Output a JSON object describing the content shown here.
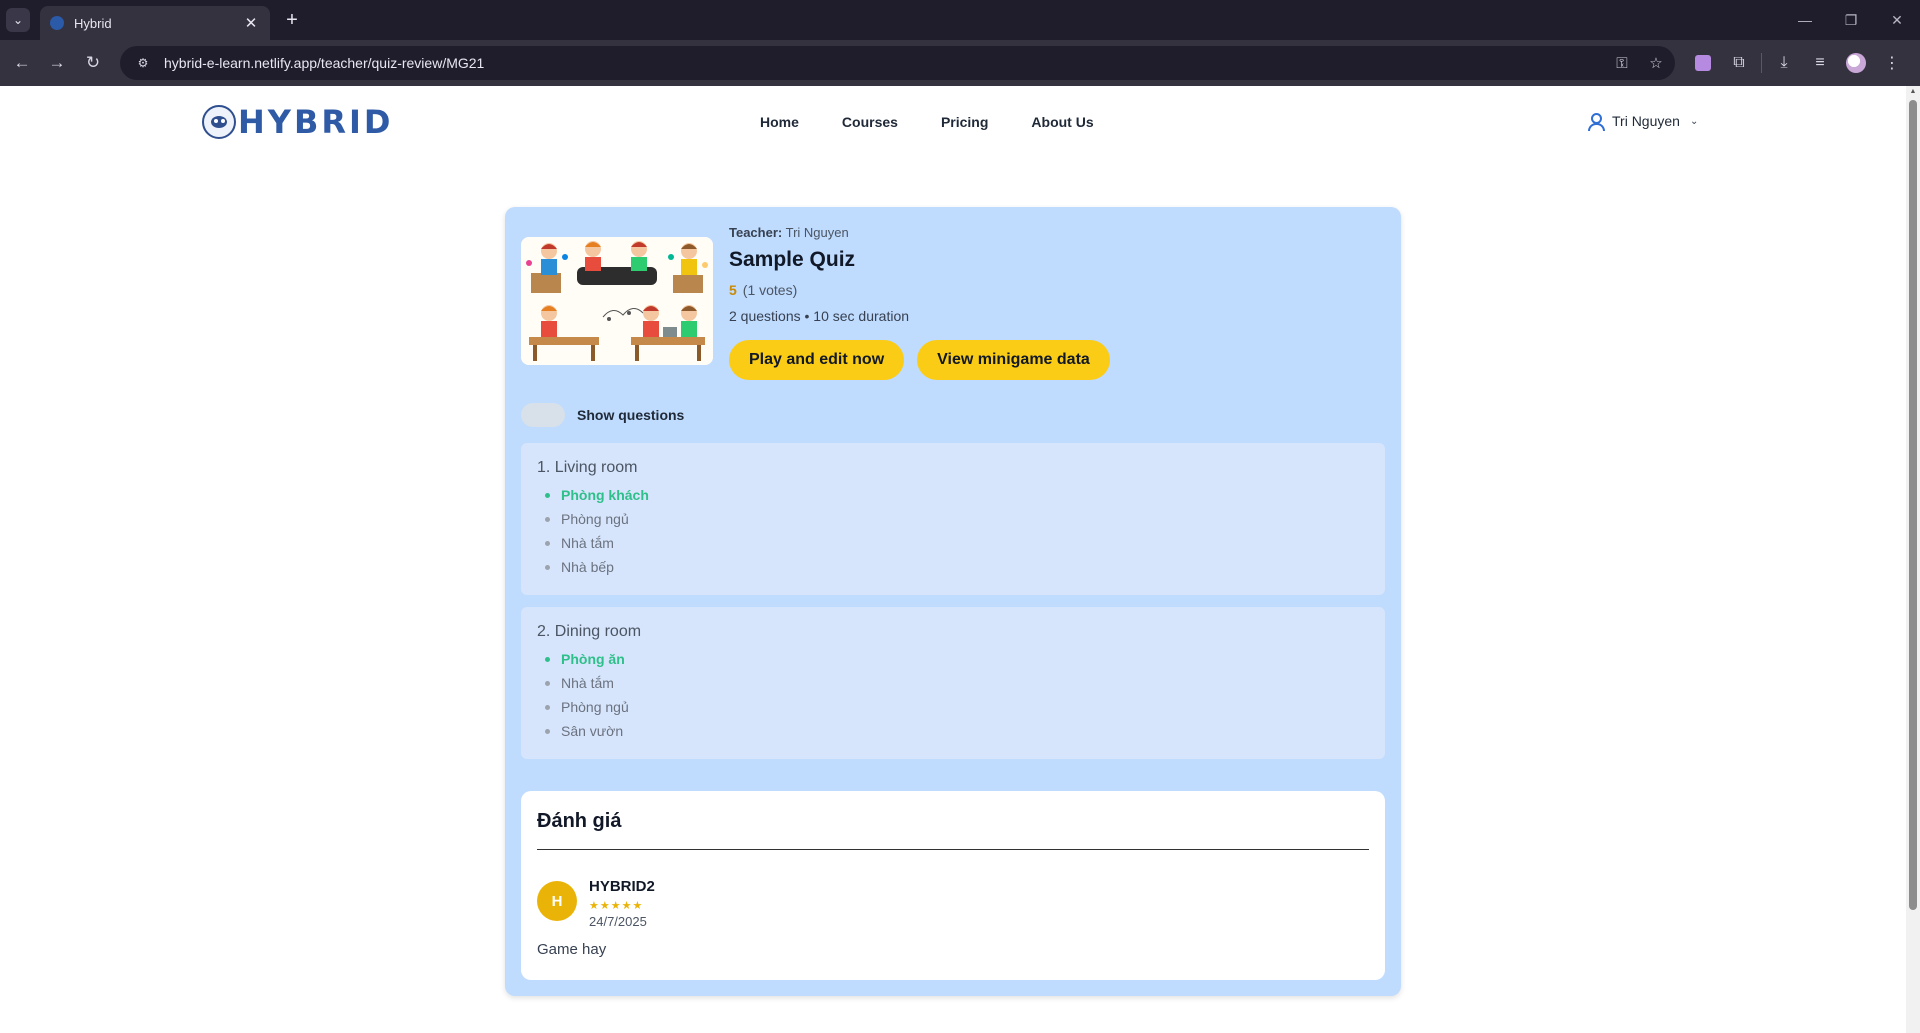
{
  "browser": {
    "tab_title": "Hybrid",
    "url": "hybrid-e-learn.netlify.app/teacher/quiz-review/MG21"
  },
  "site": {
    "logo_text": "HYBRID",
    "nav": [
      "Home",
      "Courses",
      "Pricing",
      "About Us"
    ],
    "user_name": "Tri Nguyen"
  },
  "quiz": {
    "teacher_label": "Teacher:",
    "teacher_name": "Tri Nguyen",
    "title": "Sample Quiz",
    "rating": "5",
    "votes": "(1 votes)",
    "meta": "2 questions • 10 sec duration",
    "play_button": "Play and edit now",
    "data_button": "View minigame data",
    "toggle_label": "Show questions",
    "show_questions": false
  },
  "questions": [
    {
      "title": "1. Living room",
      "answers": [
        "Phòng khách",
        "Phòng ngủ",
        "Nhà tắm",
        "Nhà bếp"
      ],
      "correct_index": 0
    },
    {
      "title": "2. Dining room",
      "answers": [
        "Phòng ăn",
        "Nhà tắm",
        "Phòng ngủ",
        "Sân vườn"
      ],
      "correct_index": 0
    }
  ],
  "reviews": {
    "heading": "Đánh giá",
    "items": [
      {
        "initial": "H",
        "user": "HYBRID2",
        "stars": "★★★★★",
        "date": "24/7/2025",
        "comment": "Game hay"
      }
    ]
  },
  "colors": {
    "card_bg": "#bfdbfe",
    "accent_yellow": "#facc15",
    "correct_green": "#2fbf8a",
    "brand_blue": "#2f5aa6"
  }
}
